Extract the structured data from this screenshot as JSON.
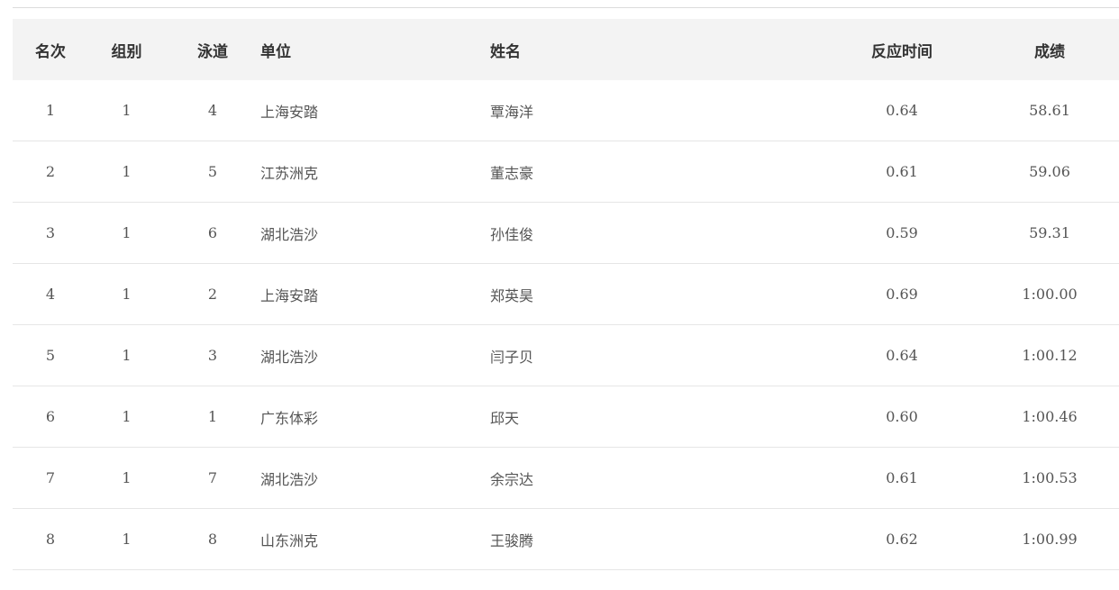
{
  "table": {
    "headers": {
      "rank": "名次",
      "group": "组别",
      "lane": "泳道",
      "unit": "单位",
      "name": "姓名",
      "reaction_time": "反应时间",
      "result": "成绩"
    },
    "rows": [
      {
        "rank": "1",
        "group": "1",
        "lane": "4",
        "unit": "上海安踏",
        "name": "覃海洋",
        "reaction_time": "0.64",
        "result": "58.61"
      },
      {
        "rank": "2",
        "group": "1",
        "lane": "5",
        "unit": "江苏洲克",
        "name": "董志豪",
        "reaction_time": "0.61",
        "result": "59.06"
      },
      {
        "rank": "3",
        "group": "1",
        "lane": "6",
        "unit": "湖北浩沙",
        "name": "孙佳俊",
        "reaction_time": "0.59",
        "result": "59.31"
      },
      {
        "rank": "4",
        "group": "1",
        "lane": "2",
        "unit": "上海安踏",
        "name": "郑英昊",
        "reaction_time": "0.69",
        "result": "1:00.00"
      },
      {
        "rank": "5",
        "group": "1",
        "lane": "3",
        "unit": "湖北浩沙",
        "name": "闫子贝",
        "reaction_time": "0.64",
        "result": "1:00.12"
      },
      {
        "rank": "6",
        "group": "1",
        "lane": "1",
        "unit": "广东体彩",
        "name": "邱天",
        "reaction_time": "0.60",
        "result": "1:00.46"
      },
      {
        "rank": "7",
        "group": "1",
        "lane": "7",
        "unit": "湖北浩沙",
        "name": "余宗达",
        "reaction_time": "0.61",
        "result": "1:00.53"
      },
      {
        "rank": "8",
        "group": "1",
        "lane": "8",
        "unit": "山东洲克",
        "name": "王骏腾",
        "reaction_time": "0.62",
        "result": "1:00.99"
      }
    ]
  }
}
